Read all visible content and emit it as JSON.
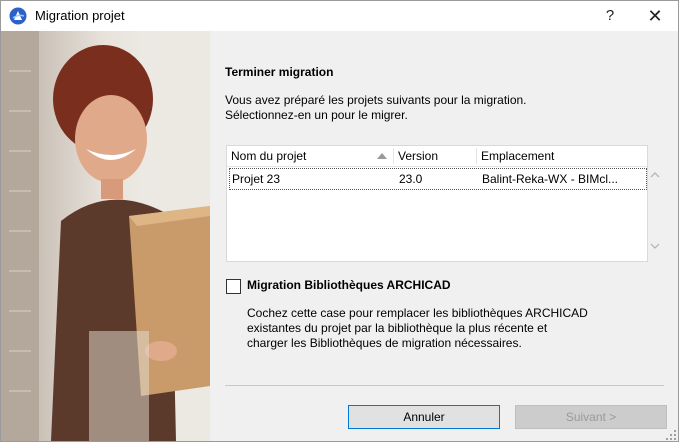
{
  "window": {
    "title": "Migration projet",
    "help_label": "?",
    "close_label": "✕"
  },
  "content": {
    "heading": "Terminer migration",
    "description_line1": "Vous avez préparé les projets suivants pour la migration.",
    "description_line2": "Sélectionnez-en un pour le migrer."
  },
  "table": {
    "columns": [
      "Nom du projet",
      "Version",
      "Emplacement"
    ],
    "rows": [
      {
        "name": "Projet 23",
        "version": "23.0",
        "location": "Balint-Reka-WX - BIMcl..."
      }
    ]
  },
  "library_migration": {
    "checkbox_label": "Migration Bibliothèques ARCHICAD",
    "checked": false,
    "help_line1": "Cochez cette case pour remplacer les bibliothèques ARCHICAD",
    "help_line2": "existantes du projet par la bibliothèque la plus récente et",
    "help_line3": "charger les Bibliothèques de migration nécessaires."
  },
  "buttons": {
    "cancel_label": "Annuler",
    "next_label": "Suivant >"
  },
  "icons": {
    "app": "archicad-logo-icon",
    "help": "help-icon",
    "close": "close-icon"
  },
  "colors": {
    "focus_border": "#0078d7",
    "app_icon": "#2a62c9"
  }
}
